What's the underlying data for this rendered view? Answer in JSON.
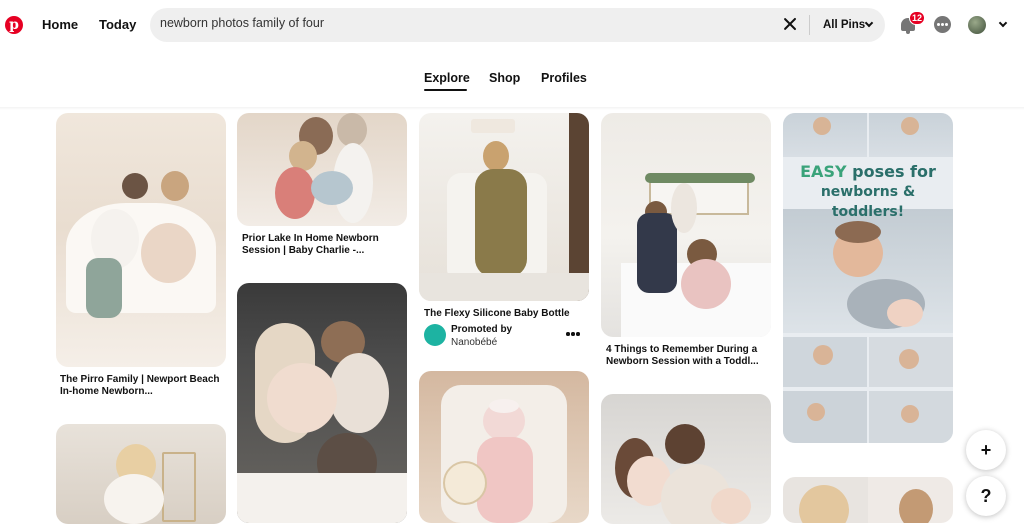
{
  "header": {
    "logo": "pinterest-logo",
    "nav": [
      "Home",
      "Today"
    ],
    "search_value": "newborn photos family of four",
    "filter_label": "All Pins",
    "notification_count": "12"
  },
  "tabs": [
    "Explore",
    "Shop",
    "Profiles"
  ],
  "active_tab": "Explore",
  "pins": [
    {
      "title": "The Pirro Family | Newport Beach In-home Newborn..."
    },
    {
      "title": "Prior Lake In Home Newborn Session | Baby Charlie -..."
    },
    {
      "title": "The Flexy Silicone Baby Bottle",
      "promoted_label": "Promoted by",
      "advertiser": "Nanobébé"
    },
    {
      "title": "4 Things to Remember During a Newborn Session with a Toddl..."
    },
    {
      "overlay_line1_a": "EASY",
      "overlay_line1_b": " poses for",
      "overlay_line2": "newborns & toddlers!"
    }
  ],
  "fab": {
    "add": "+",
    "help": "?"
  }
}
